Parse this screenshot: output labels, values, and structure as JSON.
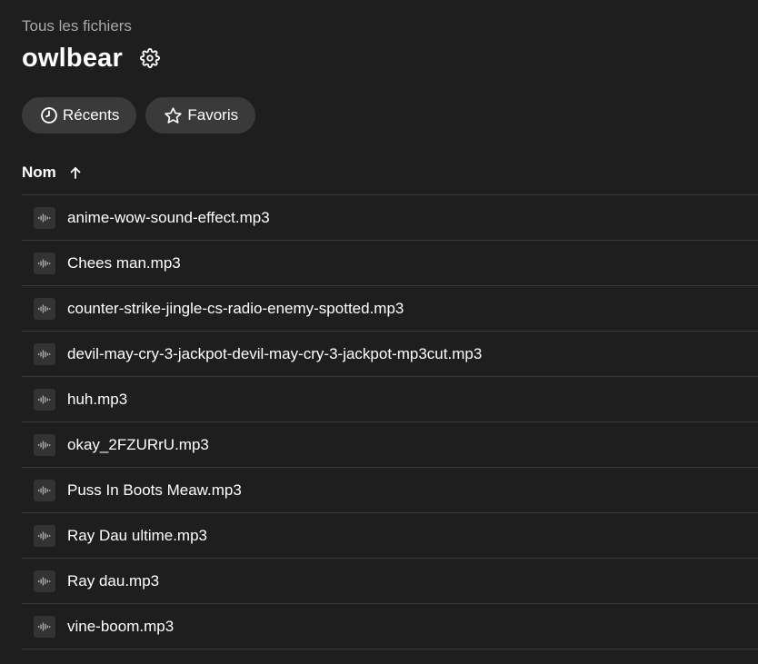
{
  "breadcrumb": {
    "label": "Tous les fichiers"
  },
  "folder": {
    "title": "owlbear",
    "settings_icon": "gear-icon"
  },
  "filters": [
    {
      "label": "Récents",
      "icon": "clock-icon"
    },
    {
      "label": "Favoris",
      "icon": "star-icon"
    }
  ],
  "column_header": {
    "label": "Nom",
    "sort_icon": "arrow-up-icon",
    "sort": "ascending"
  },
  "files": [
    {
      "name": "anime-wow-sound-effect.mp3",
      "icon": "audio-file-icon"
    },
    {
      "name": "Chees man.mp3",
      "icon": "audio-file-icon"
    },
    {
      "name": "counter-strike-jingle-cs-radio-enemy-spotted.mp3",
      "icon": "audio-file-icon"
    },
    {
      "name": "devil-may-cry-3-jackpot-devil-may-cry-3-jackpot-mp3cut.mp3",
      "icon": "audio-file-icon"
    },
    {
      "name": "huh.mp3",
      "icon": "audio-file-icon"
    },
    {
      "name": "okay_2FZURrU.mp3",
      "icon": "audio-file-icon"
    },
    {
      "name": "Puss In Boots Meaw.mp3",
      "icon": "audio-file-icon"
    },
    {
      "name": "Ray Dau ultime.mp3",
      "icon": "audio-file-icon"
    },
    {
      "name": "Ray dau.mp3",
      "icon": "audio-file-icon"
    },
    {
      "name": "vine-boom.mp3",
      "icon": "audio-file-icon"
    }
  ],
  "colors": {
    "background": "#1e1e1e",
    "chip_background": "#3a3a3a",
    "divider": "#3a3a3a",
    "muted_text": "#a8a8a8",
    "text": "#ffffff"
  }
}
